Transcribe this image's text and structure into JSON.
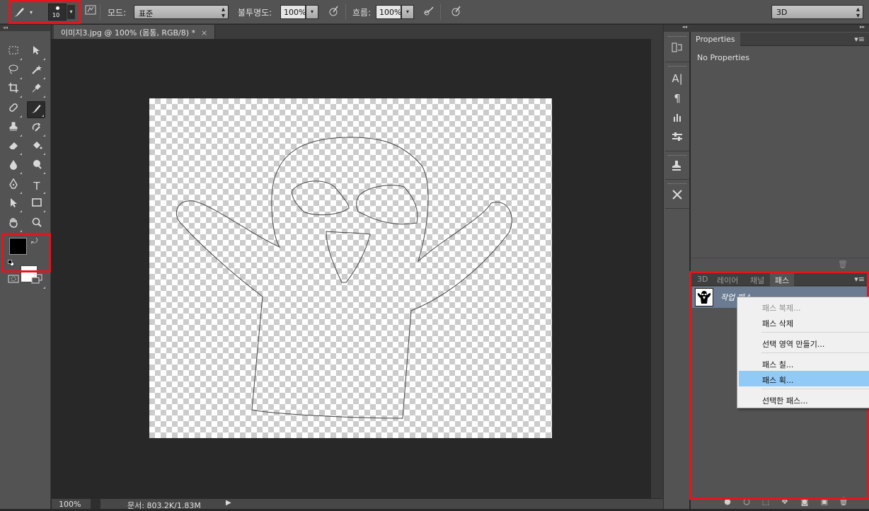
{
  "options_bar": {
    "brush_size": "10",
    "mode_label": "모드:",
    "mode_value": "표준",
    "opacity_label": "불투명도:",
    "opacity_value": "100%",
    "flow_label": "흐름:",
    "flow_value": "100%",
    "workspace_value": "3D"
  },
  "document": {
    "tab_title": "이미지3.jpg @ 100% (몸통, RGB/8) *",
    "tab_close": "×",
    "zoom": "100%",
    "doc_size": "문서: 803.2K/1.83M"
  },
  "properties_panel": {
    "tab_label": "Properties",
    "content": "No Properties"
  },
  "paths_panel": {
    "tabs": [
      "3D",
      "레이어",
      "채널",
      "패스"
    ],
    "active_tab": "패스",
    "path_name": "작업 패스"
  },
  "context_menu": {
    "items": [
      {
        "label": "패스 복제...",
        "disabled": true
      },
      {
        "label": "패스 삭제"
      },
      {
        "label": "선택 영역 만들기..."
      },
      {
        "label": "패스 칠..."
      },
      {
        "label": "패스 획...",
        "highlighted": true
      },
      {
        "label": "선택한 패스..."
      }
    ]
  },
  "colors": {
    "foreground": "#000000",
    "background": "#ffffff",
    "highlight_red": "#e8141c",
    "menu_highlight": "#91c9f7"
  }
}
